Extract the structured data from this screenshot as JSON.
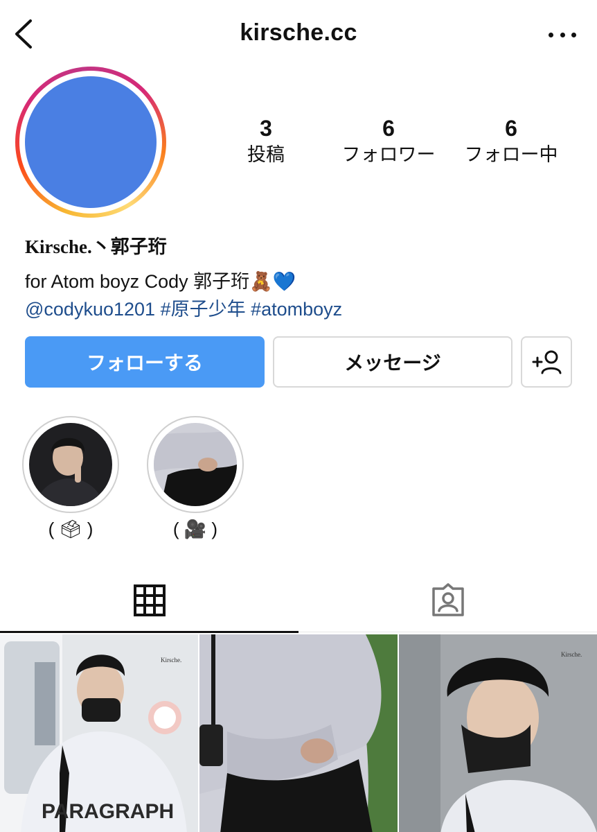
{
  "header": {
    "username": "kirsche.cc"
  },
  "stats": [
    {
      "value": "3",
      "label": "投稿"
    },
    {
      "value": "6",
      "label": "フォロワー"
    },
    {
      "value": "6",
      "label": "フォロー中"
    }
  ],
  "profile": {
    "display_name": "Kirsche.丶郭子珩",
    "bio": "for Atom boyz Cody 郭子珩🧸💙",
    "bio_mention": "@codykuo1201",
    "bio_hashtag_1": "#原子少年",
    "bio_hashtag_2": "#atomboyz"
  },
  "buttons": {
    "follow": "フォローする",
    "message": "メッセージ"
  },
  "highlights": [
    {
      "label": "( 🗳 )"
    },
    {
      "label": "( 🎥 )"
    }
  ],
  "posts": [
    {
      "watermark": "Kirsche.",
      "shirt_text": "PARAGRAPH"
    },
    {
      "watermark": ""
    },
    {
      "watermark": "Kirsche."
    }
  ],
  "colors": {
    "accent": "#4a9af5",
    "link": "#1e4d8c",
    "avatar_fill": "#4a7fe3"
  }
}
